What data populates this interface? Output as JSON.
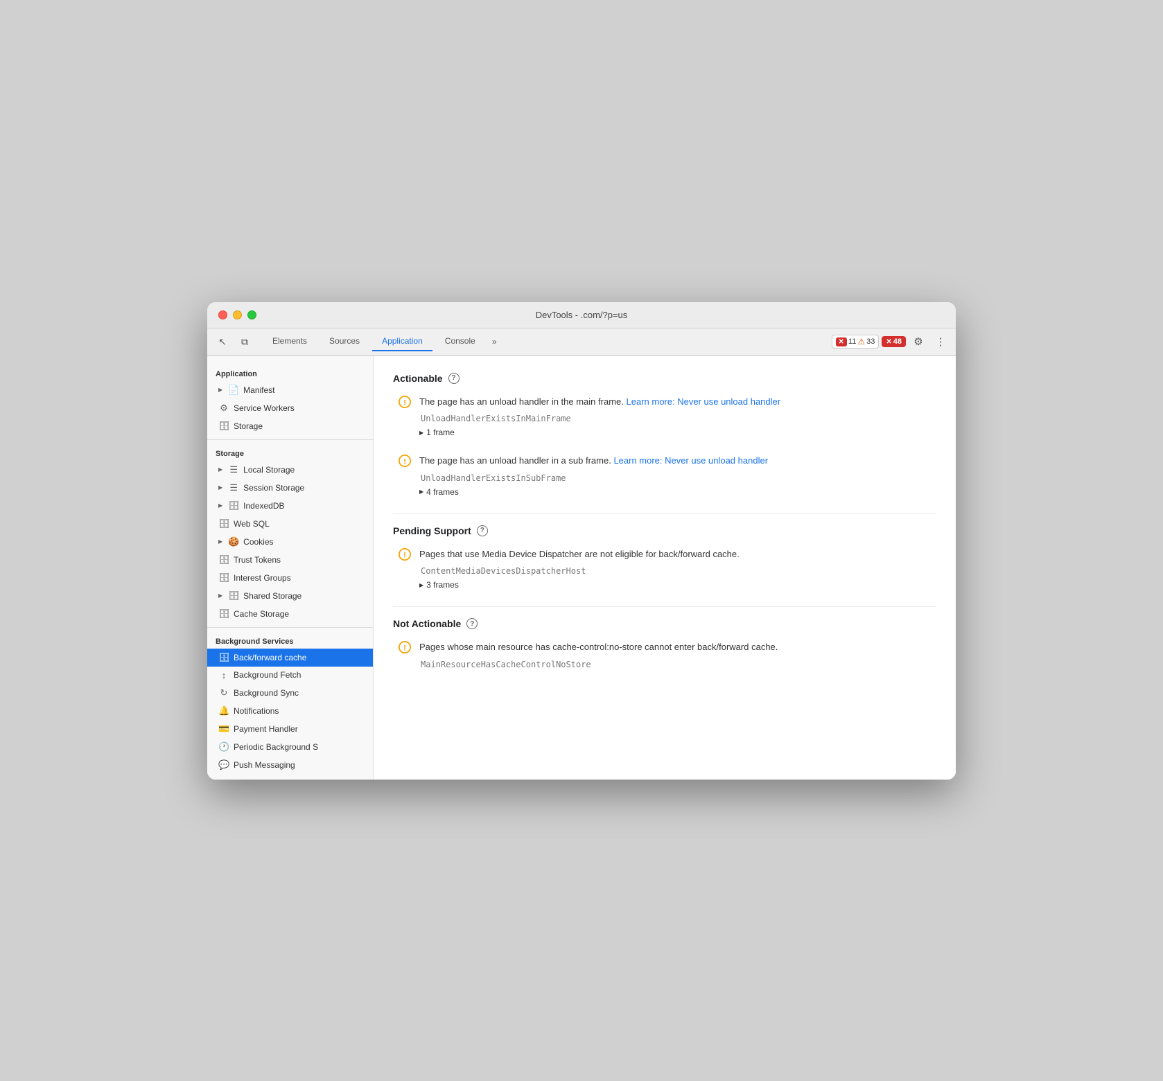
{
  "window": {
    "title": "DevTools -      .com/?p=us"
  },
  "tabs": [
    {
      "id": "elements",
      "label": "Elements",
      "active": false
    },
    {
      "id": "sources",
      "label": "Sources",
      "active": false
    },
    {
      "id": "application",
      "label": "Application",
      "active": true
    },
    {
      "id": "console",
      "label": "Console",
      "active": false
    }
  ],
  "tab_more": "»",
  "badges": {
    "errors": {
      "icon": "✕",
      "count": "11"
    },
    "warnings": {
      "icon": "▲",
      "count": "33"
    },
    "issues": {
      "icon": "✕",
      "count": "48"
    }
  },
  "sidebar": {
    "sections": [
      {
        "label": "Application",
        "items": [
          {
            "id": "manifest",
            "label": "Manifest",
            "icon": "▶",
            "icon2": "📄",
            "indent": 1
          },
          {
            "id": "service-workers",
            "label": "Service Workers",
            "icon": "⚙",
            "indent": 1
          },
          {
            "id": "storage-top",
            "label": "Storage",
            "icon": "🗄",
            "indent": 1
          }
        ]
      },
      {
        "label": "Storage",
        "items": [
          {
            "id": "local-storage",
            "label": "Local Storage",
            "icon": "▶",
            "icon2": "☰",
            "indent": 1
          },
          {
            "id": "session-storage",
            "label": "Session Storage",
            "icon": "▶",
            "icon2": "☰",
            "indent": 1
          },
          {
            "id": "indexeddb",
            "label": "IndexedDB",
            "icon": "▶",
            "icon2": "🗄",
            "indent": 1
          },
          {
            "id": "web-sql",
            "label": "Web SQL",
            "icon": "🗄",
            "indent": 1
          },
          {
            "id": "cookies",
            "label": "Cookies",
            "icon": "▶",
            "icon2": "🍪",
            "indent": 1
          },
          {
            "id": "trust-tokens",
            "label": "Trust Tokens",
            "icon": "🗄",
            "indent": 1
          },
          {
            "id": "interest-groups",
            "label": "Interest Groups",
            "icon": "🗄",
            "indent": 1
          },
          {
            "id": "shared-storage",
            "label": "Shared Storage",
            "icon": "▶",
            "icon2": "🗄",
            "indent": 1
          },
          {
            "id": "cache-storage",
            "label": "Cache Storage",
            "icon": "🗄",
            "indent": 1
          }
        ]
      },
      {
        "label": "Background Services",
        "items": [
          {
            "id": "back-forward-cache",
            "label": "Back/forward cache",
            "icon": "🗄",
            "indent": 1,
            "active": true
          },
          {
            "id": "background-fetch",
            "label": "Background Fetch",
            "icon": "↕",
            "indent": 1
          },
          {
            "id": "background-sync",
            "label": "Background Sync",
            "icon": "↻",
            "indent": 1
          },
          {
            "id": "notifications",
            "label": "Notifications",
            "icon": "🔔",
            "indent": 1
          },
          {
            "id": "payment-handler",
            "label": "Payment Handler",
            "icon": "💳",
            "indent": 1
          },
          {
            "id": "periodic-background",
            "label": "Periodic Background S",
            "icon": "🕐",
            "indent": 1
          },
          {
            "id": "push-messaging",
            "label": "Push Messaging",
            "icon": "💬",
            "indent": 1
          }
        ]
      }
    ]
  },
  "panel": {
    "sections": [
      {
        "id": "actionable",
        "title": "Actionable",
        "issues": [
          {
            "id": "unload-main",
            "description": "The page has an unload handler in the main frame.",
            "link_text": "Learn more: Never use unload handler",
            "link_href": "#",
            "code": "UnloadHandlerExistsInMainFrame",
            "frames_label": "1 frame"
          },
          {
            "id": "unload-sub",
            "description": "The page has an unload handler in a sub frame.",
            "link_text": "Learn more: Never use unload handler",
            "link_href": "#",
            "code": "UnloadHandlerExistsInSubFrame",
            "frames_label": "4 frames"
          }
        ]
      },
      {
        "id": "pending-support",
        "title": "Pending Support",
        "issues": [
          {
            "id": "media-device",
            "description": "Pages that use Media Device Dispatcher are not eligible for back/forward cache.",
            "link_text": null,
            "link_href": null,
            "code": "ContentMediaDevicesDispatcherHost",
            "frames_label": "3 frames"
          }
        ]
      },
      {
        "id": "not-actionable",
        "title": "Not Actionable",
        "issues": [
          {
            "id": "cache-control",
            "description": "Pages whose main resource has cache-control:no-store cannot enter back/forward cache.",
            "link_text": null,
            "link_href": null,
            "code": "MainResourceHasCacheControlNoStore",
            "frames_label": null
          }
        ]
      }
    ]
  },
  "icons": {
    "cursor": "↖",
    "layers": "⧉",
    "gear": "⚙",
    "more": "⋮",
    "question": "?"
  }
}
